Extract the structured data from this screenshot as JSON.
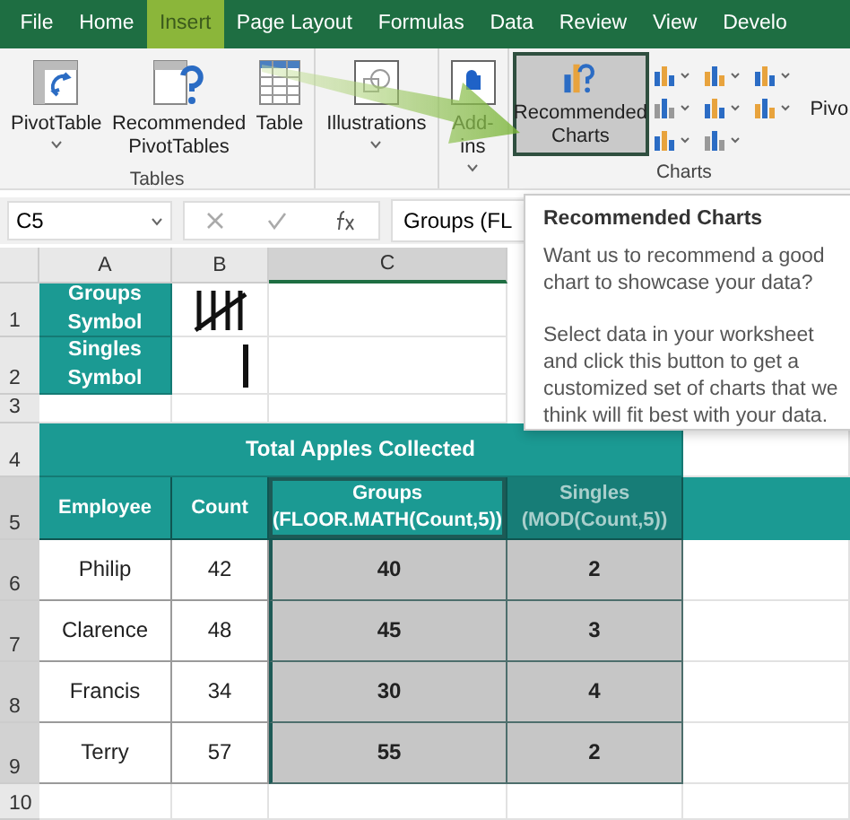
{
  "menu_tabs": [
    {
      "label": "File",
      "selected": false
    },
    {
      "label": "Home",
      "selected": false
    },
    {
      "label": "Insert",
      "selected": true
    },
    {
      "label": "Page Layout",
      "selected": false
    },
    {
      "label": "Formulas",
      "selected": false
    },
    {
      "label": "Data",
      "selected": false
    },
    {
      "label": "Review",
      "selected": false
    },
    {
      "label": "View",
      "selected": false
    },
    {
      "label": "Develo",
      "selected": false
    }
  ],
  "ribbon_groups": [
    {
      "label": "Tables",
      "buttons": [
        {
          "kind": "pivot",
          "label": "PivotTable",
          "dropdown": true,
          "selected": false
        },
        {
          "kind": "recpivot",
          "label": "Recommended PivotTables",
          "dropdown": false,
          "selected": false
        },
        {
          "kind": "table",
          "label": "Table",
          "dropdown": false,
          "selected": false
        }
      ]
    },
    {
      "buttons": [
        {
          "kind": "shapes",
          "label": "Illustrations",
          "dropdown": true,
          "selected": false
        }
      ]
    },
    {
      "buttons": [
        {
          "kind": "addins",
          "label": "Add-ins",
          "dropdown": true,
          "selected": false
        }
      ]
    },
    {
      "label": "Charts",
      "buttons": [
        {
          "kind": "recchart",
          "label": "Recommended Charts",
          "dropdown": false,
          "selected": true
        },
        {
          "kind": "chartgrid"
        },
        {
          "kind": "cut",
          "label": "Pivo"
        }
      ]
    }
  ],
  "formula_bar": {
    "name_box": "C5",
    "formula": "Groups (FL"
  },
  "sheet": {
    "column_headers": [
      {
        "label": "A",
        "selected": false
      },
      {
        "label": "B",
        "selected": false
      },
      {
        "label": "C",
        "selected": true
      }
    ],
    "row_numbers": [
      {
        "label": "1",
        "selected": false
      },
      {
        "label": "2",
        "selected": false
      },
      {
        "label": "3",
        "selected": false
      },
      {
        "label": "4",
        "selected": false
      },
      {
        "label": "5",
        "selected": true
      },
      {
        "label": "6",
        "selected": true
      },
      {
        "label": "7",
        "selected": true
      },
      {
        "label": "8",
        "selected": true
      },
      {
        "label": "9",
        "selected": true
      },
      {
        "label": "10",
        "selected": false
      }
    ],
    "symbols": [
      {
        "label": "Groups Symbol",
        "kind": "group"
      },
      {
        "label": "Singles Symbol",
        "kind": "single"
      }
    ],
    "table_title": "Total Apples Collected",
    "columns": [
      {
        "label": "Employee",
        "selected": false,
        "active": false
      },
      {
        "label": "Count",
        "selected": false,
        "active": false
      },
      {
        "label": "Groups (FLOOR.MATH(Count,5))",
        "selected": true,
        "active": true
      },
      {
        "label": "Singles (MOD(Count,5))",
        "selected": true,
        "active": false
      }
    ],
    "rows": [
      [
        "Philip",
        "42",
        "40",
        "2"
      ],
      [
        "Clarence",
        "48",
        "45",
        "3"
      ],
      [
        "Francis",
        "34",
        "30",
        "4"
      ],
      [
        "Terry",
        "57",
        "55",
        "2"
      ]
    ]
  },
  "tooltip": {
    "title": "Recommended Charts",
    "paragraphs": [
      "Want us to recommend a good chart to showcase your data?",
      "Select data in your worksheet and click this button to get a customized set of charts that we think will fit best with your data."
    ]
  }
}
